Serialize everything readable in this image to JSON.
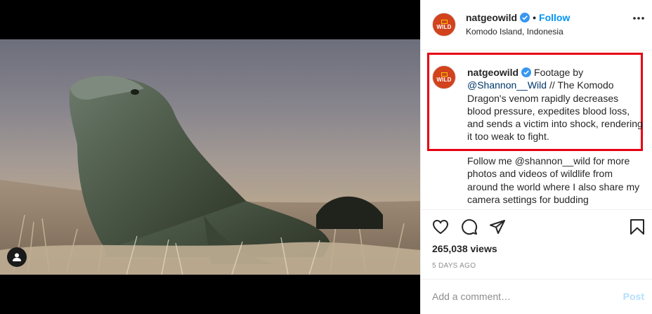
{
  "post": {
    "username": "natgeowild",
    "follow_label": "Follow",
    "separator": "•",
    "location": "Komodo Island, Indonesia"
  },
  "avatar": {
    "label": "WILD",
    "brand_color": "#d2421d",
    "accent_color": "#f7c600"
  },
  "caption": {
    "username": "natgeowild",
    "text_before": " Footage by ",
    "mention_1": "@Shannon__Wild",
    "text_after": " // The Komodo Dragon's venom rapidly decreases blood pressure, expedites blood loss, and sends a victim into shock, rendering it too weak to fight.",
    "follow_text_before": "Follow me ",
    "mention_2": "@shannon__wild",
    "follow_text_after": " for more photos and videos of wildlife from around the world where I also share my camera settings for budding"
  },
  "stats": {
    "views": "265,038 views",
    "time_ago": "5 DAYS AGO"
  },
  "comment_box": {
    "placeholder": "Add a comment…",
    "post_label": "Post"
  },
  "icons": {
    "media": [
      "user-tag-icon"
    ],
    "header": [
      "verified-badge-icon",
      "more-options-icon"
    ],
    "actions": [
      "heart-icon",
      "comment-icon",
      "share-icon",
      "bookmark-icon"
    ]
  },
  "colors": {
    "link": "#0095f6",
    "mention": "#00376b",
    "highlight_box": "#e60012",
    "muted": "#8e8e8e"
  }
}
